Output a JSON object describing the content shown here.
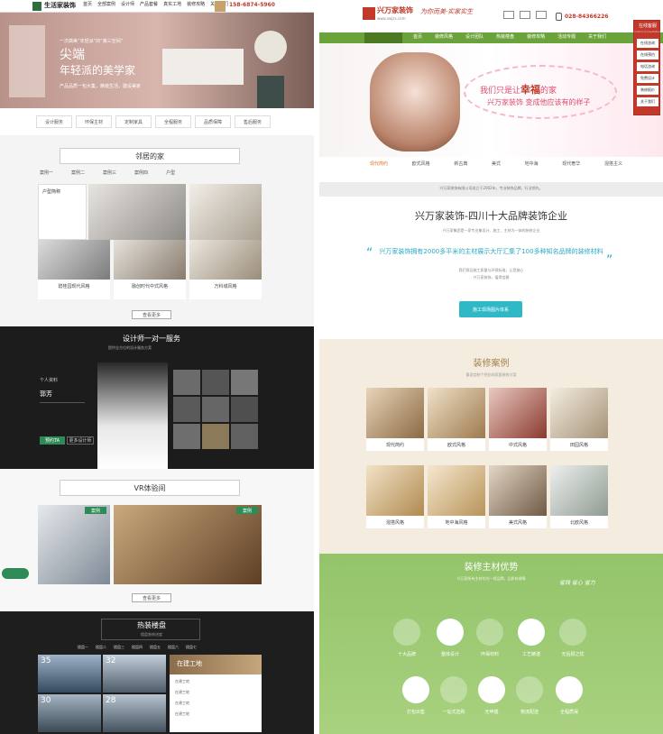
{
  "left": {
    "brand": {
      "name": "生活家装饰"
    },
    "nav": [
      "首页",
      "全部案例",
      "设计师",
      "产品套餐",
      "真实工地",
      "装修攻略",
      "关于我们"
    ],
    "phone": "158-6874-5960",
    "hero": {
      "top_line": "一次搞美“年轻派”的“第三空间”",
      "title1": "尖端",
      "title2": "年轻派的美学家",
      "sub": "产品品质一包大集，精装生活，建设美家"
    },
    "features": [
      "设计服务",
      "环保主材",
      "定制家具",
      "全程服务",
      "品质保障",
      "售后服务"
    ],
    "cases": {
      "title": "邻居的家",
      "tabs": [
        "案例一",
        "案例二",
        "案例三",
        "案例四",
        "户型"
      ],
      "card_title": "户型简称",
      "items": [
        "碧桂园现代风格",
        "融创时代中式风格",
        "万科城风格"
      ],
      "more": "查看更多"
    },
    "designer": {
      "title": "设计师一对一服务",
      "sub": "提供全方位的设计服务方案",
      "label": "个人资料",
      "name": "郭芳",
      "btn1": "预约TA",
      "btn2": "更多设计师"
    },
    "vr": {
      "title": "VR体验间",
      "more": "查看更多",
      "tag": "案例"
    },
    "hot": {
      "title": "热装楼盘",
      "sub": "楼盘装修进度",
      "tabs": [
        "楼盘一",
        "楼盘二",
        "楼盘三",
        "楼盘四",
        "楼盘五",
        "楼盘六",
        "楼盘七"
      ],
      "nums": [
        "35",
        "32",
        "30",
        "28"
      ],
      "site_title": "在建工地",
      "rows": [
        "在建工地",
        "在建工地",
        "在建工地",
        "在建工地"
      ]
    }
  },
  "right": {
    "brand": {
      "name": "兴万家装饰",
      "url": "www.xwjzs.com"
    },
    "slogan": "为你而美·实家实生",
    "phone": "028-84366226",
    "nav": [
      "首页",
      "装修风格",
      "设计团队",
      "热装楼盘",
      "装修攻略",
      "活动专题",
      "关于我们"
    ],
    "hero": {
      "line1": "我们只是让",
      "highlight": "幸福",
      "line1b": "的家",
      "line2": "兴万家装饰 变成他应该有的样子"
    },
    "icons": [
      "现代简约",
      "欧式风格",
      "新古典",
      "美式",
      "地中海",
      "现代奢华",
      "混搭主义"
    ],
    "intro": {
      "top": "兴万家装饰有限公司成立于2002年，专业装饰品牌，行业领先。",
      "title": "兴万家装饰-四川十大品牌装饰企业",
      "sub": "兴万家集团是一家专业集设计、施工、主材为一体的装修企业",
      "quote": "兴万家装饰拥有2000多平米的主材展示大厅汇集了100多种知名品牌的装修材料",
      "line1": "我们保证施工质量与环保标准，让您放心",
      "line2": "兴万家装饰，值得信赖",
      "button": "施工现场图片体系"
    },
    "cases": {
      "title": "装修案例",
      "sub": "量身定制个性化的家居装修方案",
      "items": [
        "现代简约",
        "欧式风格",
        "中式风格",
        "田园风格",
        "混搭风格",
        "地中海风格",
        "美式风格",
        "北欧风格"
      ]
    },
    "materials": {
      "title": "装修主材优势",
      "sub": "兴万家所有主材均为一线品牌，品质有保障",
      "script": "省钱 省心 省力",
      "items": [
        "十大品牌",
        "整体设计",
        "环保材料",
        "工艺精湛",
        "无后顾之忧",
        "打包出售",
        "一站式选购",
        "无甲醛",
        "物流配送",
        "全程质保"
      ]
    },
    "sidebar": {
      "title": "在线客服",
      "sub": "Online Consultation",
      "items": [
        "在线咨询",
        "在线预约",
        "电话咨询",
        "免费设计",
        "装修报价",
        "关于我们"
      ]
    }
  }
}
